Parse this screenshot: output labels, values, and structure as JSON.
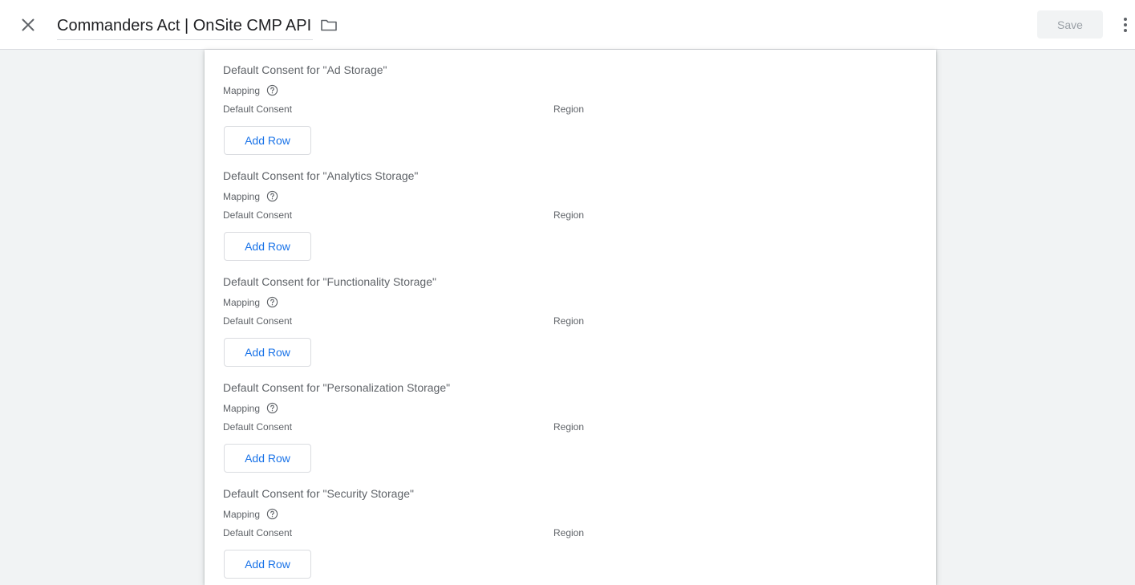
{
  "header": {
    "close_icon": "close-icon",
    "title": "Commanders Act | OnSite CMP API",
    "folder_icon": "folder-icon",
    "save_label": "Save",
    "more_icon": "more-vert-icon"
  },
  "sections": [
    {
      "title": "Default Consent for \"Ad Storage\"",
      "mapping_label": "Mapping",
      "col_default": "Default Consent",
      "col_region": "Region",
      "add_row_label": "Add Row"
    },
    {
      "title": "Default Consent for \"Analytics Storage\"",
      "mapping_label": "Mapping",
      "col_default": "Default Consent",
      "col_region": "Region",
      "add_row_label": "Add Row"
    },
    {
      "title": "Default Consent for \"Functionality Storage\"",
      "mapping_label": "Mapping",
      "col_default": "Default Consent",
      "col_region": "Region",
      "add_row_label": "Add Row"
    },
    {
      "title": "Default Consent for \"Personalization Storage\"",
      "mapping_label": "Mapping",
      "col_default": "Default Consent",
      "col_region": "Region",
      "add_row_label": "Add Row"
    },
    {
      "title": "Default Consent for \"Security Storage\"",
      "mapping_label": "Mapping",
      "col_default": "Default Consent",
      "col_region": "Region",
      "add_row_label": "Add Row"
    }
  ],
  "colors": {
    "accent": "#1a73e8",
    "text_secondary": "#5f6368",
    "background": "#f1f3f4",
    "border": "#dadce0"
  }
}
